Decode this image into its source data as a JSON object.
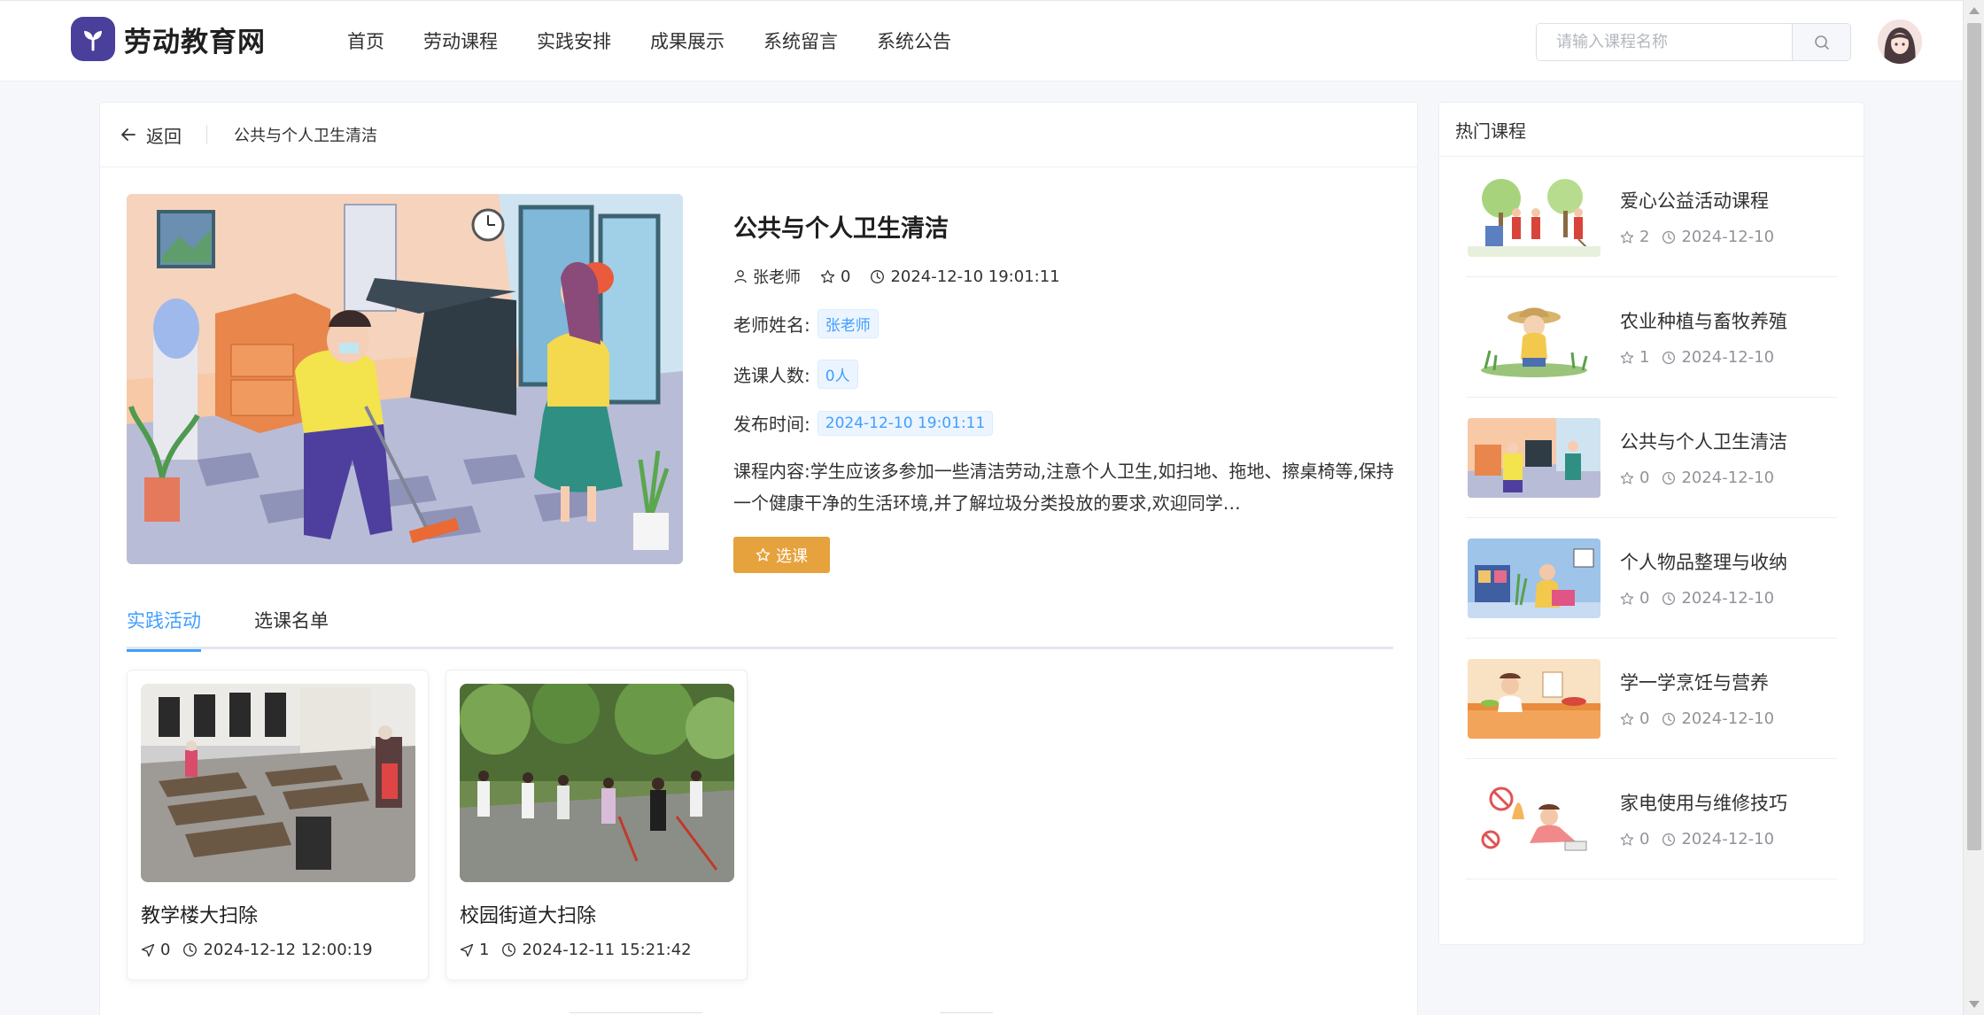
{
  "header": {
    "logo_text": "劳动教育网",
    "nav": [
      "首页",
      "劳动课程",
      "实践安排",
      "成果展示",
      "系统留言",
      "系统公告"
    ],
    "search_placeholder": "请输入课程名称"
  },
  "breadcrumb": {
    "back_label": "返回",
    "current": "公共与个人卫生清洁"
  },
  "course": {
    "title": "公共与个人卫生清洁",
    "teacher": "张老师",
    "stars": "0",
    "datetime": "2024-12-10 19:01:11",
    "teacher_label": "老师姓名:",
    "teacher_value": "张老师",
    "count_label": "选课人数:",
    "count_value": "0人",
    "publish_label": "发布时间:",
    "publish_value": "2024-12-10 19:01:11",
    "content": "课程内容:学生应该多参加一些清洁劳动,注意个人卫生,如扫地、拖地、擦桌椅等,保持一个健康干净的生活环境,并了解垃圾分类投放的要求,欢迎同学…",
    "select_button": "选课"
  },
  "tabs": [
    {
      "label": "实践活动",
      "active": true
    },
    {
      "label": "选课名单",
      "active": false
    }
  ],
  "activities": [
    {
      "title": "教学楼大扫除",
      "likes": "0",
      "datetime": "2024-12-12 12:00:19"
    },
    {
      "title": "校园街道大扫除",
      "likes": "1",
      "datetime": "2024-12-11 15:21:42"
    }
  ],
  "sidebar": {
    "title": "热门课程",
    "items": [
      {
        "title": "爱心公益活动课程",
        "stars": "2",
        "date": "2024-12-10"
      },
      {
        "title": "农业种植与畜牧养殖",
        "stars": "1",
        "date": "2024-12-10"
      },
      {
        "title": "公共与个人卫生清洁",
        "stars": "0",
        "date": "2024-12-10"
      },
      {
        "title": "个人物品整理与收纳",
        "stars": "0",
        "date": "2024-12-10"
      },
      {
        "title": "学一学烹饪与营养",
        "stars": "0",
        "date": "2024-12-10"
      },
      {
        "title": "家电使用与维修技巧",
        "stars": "0",
        "date": "2024-12-10"
      }
    ]
  },
  "colors": {
    "accent": "#409eff",
    "select_button": "#e6a23c",
    "logo": "#4a3f9a"
  }
}
